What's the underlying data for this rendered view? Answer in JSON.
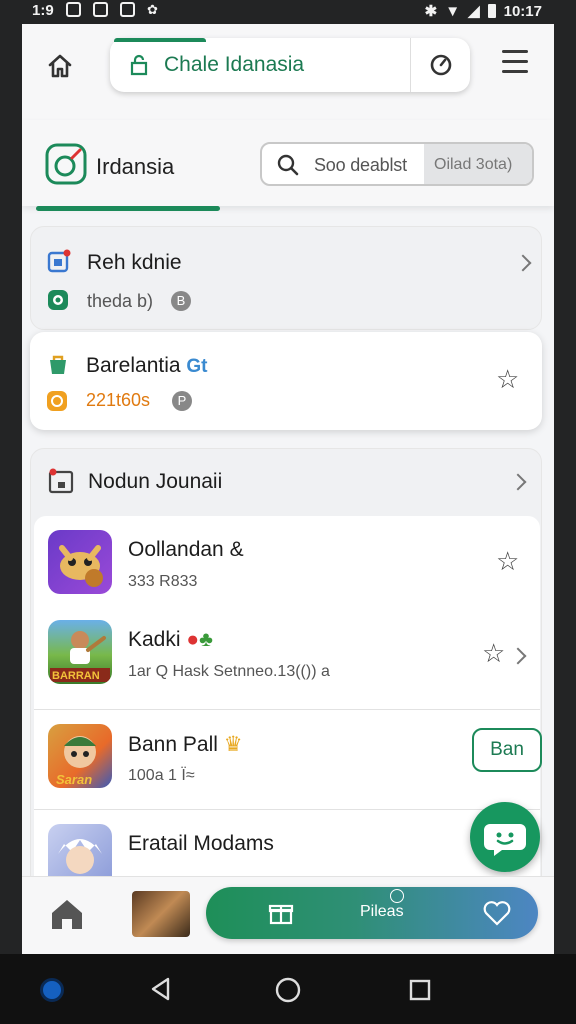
{
  "status_bar": {
    "time_left": "1:9",
    "time_right": "10:17"
  },
  "browser": {
    "url": "Chale Idanasia"
  },
  "site": {
    "brand": "Irdansia",
    "search_placeholder": "Soo deablst",
    "search_chip": "Oilad 3ota)"
  },
  "sections": [
    {
      "title": "Reh kdnie",
      "subtitle": "theda b)",
      "subtitle_badge": "B"
    },
    {
      "title": "Barelantia",
      "title_tag": "Gt",
      "subtitle": "221t60s",
      "subtitle_badge": "P"
    }
  ],
  "list_section": {
    "title": "Nodun Jounaii",
    "apps": [
      {
        "name": "Oollandan &",
        "meta": "333 R833",
        "icon": "dragon-game-icon",
        "action": "star"
      },
      {
        "name": "Kadki",
        "meta": "1ar  Q  Hask Setnneo.13(())  a",
        "icon": "cricket-game-icon",
        "icon_label": "BARRAN",
        "action": "star-chevron"
      },
      {
        "name": "Bann Pall",
        "meta": "100a 1  Ï≈",
        "icon": "hero-game-icon",
        "icon_label": "Saran",
        "action": "get",
        "action_label": "Ban"
      },
      {
        "name": "Eratail Modams",
        "meta": "",
        "icon": "anime-game-icon",
        "action": "none"
      }
    ]
  },
  "bottom_nav": {
    "pill_label": "Pileas"
  },
  "colors": {
    "accent": "#1c8a5a",
    "pill_end": "#4d86c3"
  }
}
